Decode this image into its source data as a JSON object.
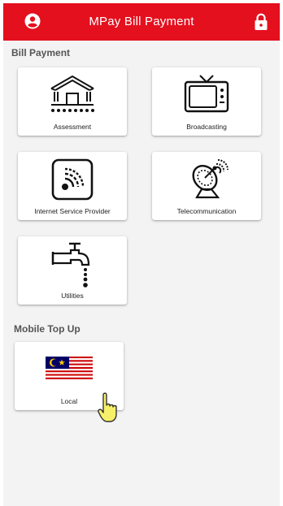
{
  "app": {
    "title": "MPay Bill Payment",
    "user_icon": "account-circle-icon",
    "lock_icon": "lock-icon",
    "brand_color": "#e4101e"
  },
  "bill_payment": {
    "heading": "Bill Payment",
    "items": [
      {
        "label": "Assessment",
        "icon": "house-icon"
      },
      {
        "label": "Broadcasting",
        "icon": "tv-icon"
      },
      {
        "label": "Internet Service Provider",
        "icon": "wifi-signal-icon"
      },
      {
        "label": "Telecommunication",
        "icon": "satellite-dish-icon"
      },
      {
        "label": "Utilities",
        "icon": "water-tap-icon"
      }
    ]
  },
  "mobile_top_up": {
    "heading": "Mobile Top Up",
    "items": [
      {
        "label": "Local",
        "icon": "malaysia-flag-icon"
      }
    ]
  }
}
